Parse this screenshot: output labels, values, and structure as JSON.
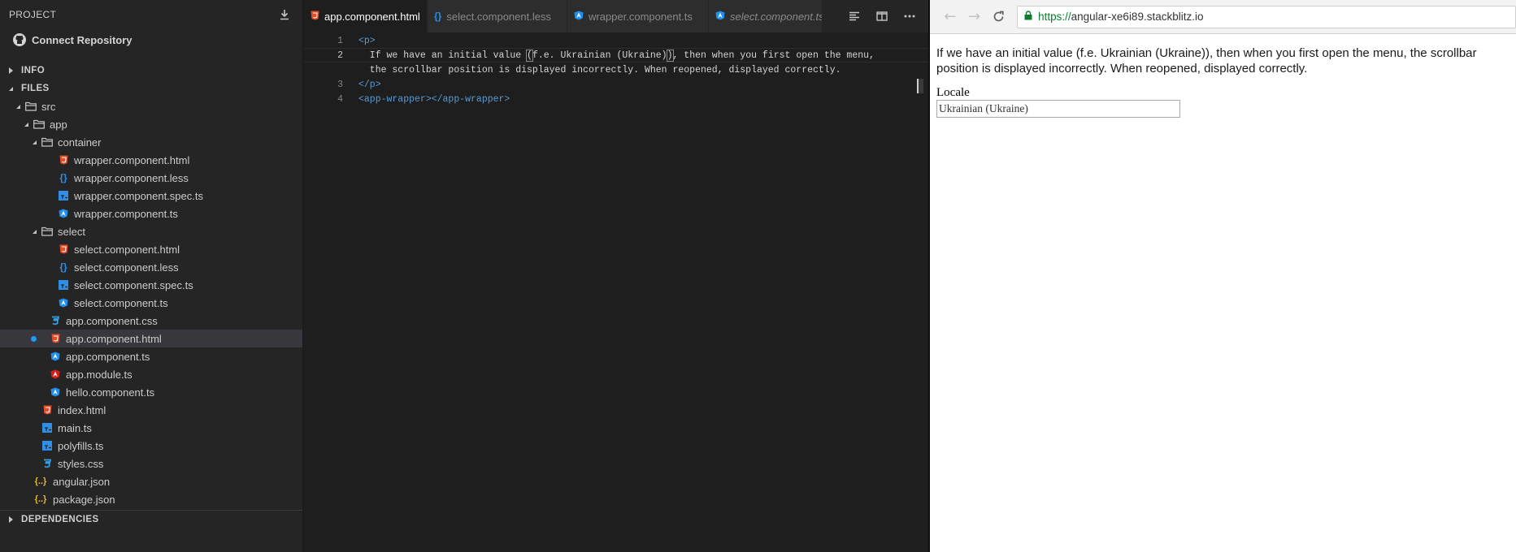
{
  "sidebar": {
    "project_title": "PROJECT",
    "connect_label": "Connect Repository",
    "info_label": "INFO",
    "files_label": "FILES",
    "deps_label": "DEPENDENCIES",
    "tree": [
      {
        "name": "src",
        "kind": "folder"
      },
      {
        "name": "app",
        "kind": "folder"
      },
      {
        "name": "container",
        "kind": "folder"
      },
      {
        "name": "wrapper.component.html",
        "kind": "html"
      },
      {
        "name": "wrapper.component.less",
        "kind": "less"
      },
      {
        "name": "wrapper.component.spec.ts",
        "kind": "ts"
      },
      {
        "name": "wrapper.component.ts",
        "kind": "angular"
      },
      {
        "name": "select",
        "kind": "folder"
      },
      {
        "name": "select.component.html",
        "kind": "html"
      },
      {
        "name": "select.component.less",
        "kind": "less"
      },
      {
        "name": "select.component.spec.ts",
        "kind": "ts"
      },
      {
        "name": "select.component.ts",
        "kind": "angular"
      },
      {
        "name": "app.component.css",
        "kind": "css"
      },
      {
        "name": "app.component.html",
        "kind": "html"
      },
      {
        "name": "app.component.ts",
        "kind": "angular"
      },
      {
        "name": "app.module.ts",
        "kind": "angular-red"
      },
      {
        "name": "hello.component.ts",
        "kind": "angular"
      },
      {
        "name": "index.html",
        "kind": "html"
      },
      {
        "name": "main.ts",
        "kind": "ts"
      },
      {
        "name": "polyfills.ts",
        "kind": "ts"
      },
      {
        "name": "styles.css",
        "kind": "css"
      },
      {
        "name": "angular.json",
        "kind": "json"
      },
      {
        "name": "package.json",
        "kind": "json"
      }
    ]
  },
  "editor": {
    "tabs": [
      {
        "label": "app.component.html"
      },
      {
        "label": "select.component.less"
      },
      {
        "label": "wrapper.component.ts"
      },
      {
        "label": "select.component.ts"
      }
    ],
    "line_numbers": [
      "1",
      "2",
      "",
      "3",
      "4"
    ],
    "code": {
      "l1": "<p>",
      "l2a": "  If we have an initial value ",
      "l2b": "(",
      "l2c": "f.e. Ukrainian (Ukraine)",
      "l2d": ")",
      "l2e": ", then when you first open the menu,",
      "l2wrap": "  the scrollbar position is displayed incorrectly. When reopened, displayed correctly.",
      "l3": "</p>",
      "l4": "<app-wrapper></app-wrapper>"
    }
  },
  "browser": {
    "url_scheme": "https://",
    "url_host": "angular-xe6i89.stackblitz.io",
    "paragraph": "If we have an initial value (f.e. Ukrainian (Ukraine)), then when you first open the menu, the scrollbar position is displayed incorrectly. When reopened, displayed correctly.",
    "locale_label": "Locale",
    "locale_value": "Ukrainian (Ukraine)"
  },
  "colors": {
    "html_icon": "#e44d26",
    "less_icon": "#2f8ee5",
    "ts_icon": "#2f8ee5",
    "angular_icon": "#1f8ff1",
    "angular_red_icon": "#dd1b16",
    "css_icon": "#3a9fe8",
    "json_icon": "#e8b730",
    "folder_icon": "#c5c5c5",
    "dirty_dot": "#1d9bf0"
  }
}
